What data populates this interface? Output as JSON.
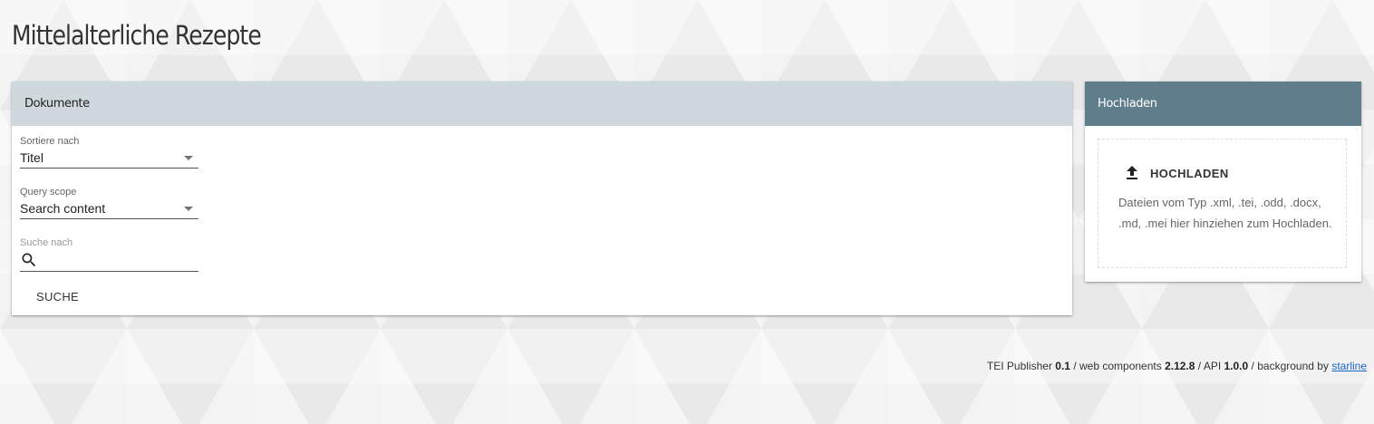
{
  "page": {
    "title": "Mittelalterliche Rezepte"
  },
  "documents_panel": {
    "header": "Dokumente",
    "sort_label": "Sortiere nach",
    "sort_value": "Titel",
    "scope_label": "Query scope",
    "scope_value": "Search content",
    "search_label": "Suche nach",
    "search_value": "",
    "search_icon": "search-icon",
    "search_button": "SUCHE"
  },
  "upload_panel": {
    "header": "Hochladen",
    "button_label": "HOCHLADEN",
    "button_icon": "upload-icon",
    "hint": "Dateien vom Typ .xml, .tei, .odd, .docx, .md, .mei hier hinziehen zum Hochladen."
  },
  "footer": {
    "publisher_label": "TEI Publisher",
    "publisher_version": "0.1",
    "sep1": "/",
    "components_label": "web components",
    "components_version": "2.12.8",
    "sep2": "/",
    "api_label": "API",
    "api_version": "1.0.0",
    "sep3": "/",
    "background_label": "background by",
    "background_link": "starline"
  },
  "colors": {
    "documents_header_bg": "#cfd8dc",
    "upload_header_bg": "#607d8b",
    "link": "#1a66c8"
  }
}
